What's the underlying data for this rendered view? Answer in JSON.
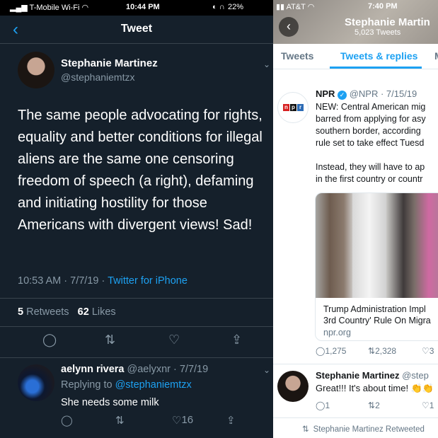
{
  "left": {
    "status": {
      "carrier": "T-Mobile Wi-Fi",
      "time": "10:44 PM",
      "battery": "22%"
    },
    "nav": {
      "title": "Tweet",
      "back": "‹"
    },
    "author": {
      "name": "Stephanie Martinez",
      "handle": "@stephaniemtzx"
    },
    "tweet_text": "The same people advocating for rights, equality and better conditions for illegal aliens are the same one censoring freedom of speech (a right), defaming and initiating hostility for those Americans with divergent views! Sad!",
    "meta": {
      "time": "10:53 AM · 7/7/19 · ",
      "client": "Twitter for iPhone"
    },
    "counts": {
      "retweets_num": "5",
      "retweets_label": " Retweets",
      "likes_num": "62",
      "likes_label": " Likes"
    },
    "reply": {
      "name": "aelynn rivera",
      "handle_date": " @aelyxnr · 7/7/19",
      "replying_prefix": "Replying to ",
      "replying_to": "@stephaniemtzx",
      "text": "She needs some milk",
      "likes": "16"
    }
  },
  "right": {
    "status": {
      "carrier": "AT&T",
      "time": "7:40 PM"
    },
    "header": {
      "name": "Stephanie Martin",
      "tweet_count": "5,023 Tweets"
    },
    "tabs": [
      "Tweets",
      "Tweets & replies",
      "M"
    ],
    "npr_tweet": {
      "name": "NPR",
      "handle_date": " @NPR · 7/15/19",
      "text": "NEW: Central American mig\nbarred from applying for asy\nsouthern border, according \nrule set to take effect Tuesd\n\nInstead, they will have to ap\nin the first country or countr",
      "card_headline": "Trump Administration Impl\n3rd Country' Rule On Migra",
      "card_domain": "npr.org",
      "replies": "1,275",
      "retweets": "2,328",
      "likes": "3"
    },
    "sm_tweet": {
      "name": "Stephanie Martinez",
      "handle": " @step",
      "text": "Great!!! It's about time! ",
      "replies": "1",
      "retweets": "2",
      "likes": "1"
    },
    "retweeted_label": "Stephanie Martinez Retweeted"
  }
}
